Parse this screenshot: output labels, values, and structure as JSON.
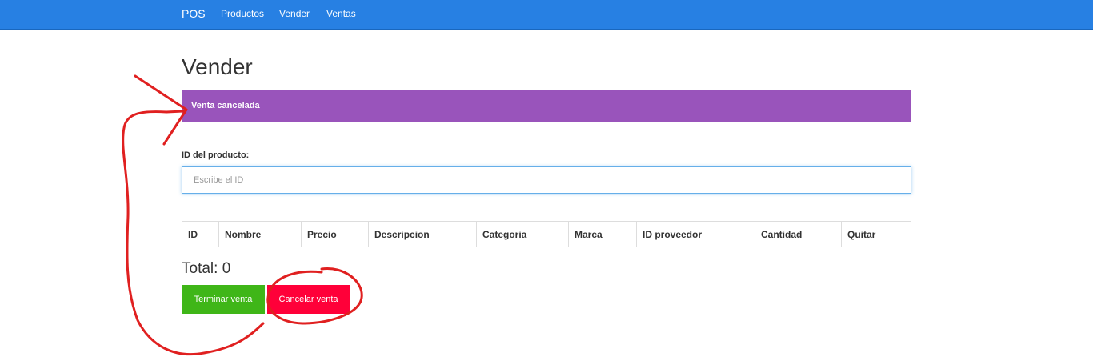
{
  "navbar": {
    "brand": "POS",
    "links": [
      "Productos",
      "Vender",
      "Ventas"
    ],
    "background": "#2780e3"
  },
  "page_title": "Vender",
  "alert": {
    "text": "Venta cancelada",
    "color": "#9954bb"
  },
  "product_form": {
    "label": "ID del producto:",
    "placeholder": "Escribe el ID",
    "value": ""
  },
  "table": {
    "columns": [
      "ID",
      "Nombre",
      "Precio",
      "Descripcion",
      "Categoria",
      "Marca",
      "ID proveedor",
      "Cantidad",
      "Quitar"
    ],
    "rows": []
  },
  "total": "Total: 0",
  "actions": {
    "finish_label": "Terminar venta",
    "finish_color": "#3fb618",
    "cancel_label": "Cancelar venta",
    "cancel_color": "#ff0039"
  },
  "annotation": {
    "color": "#e02020"
  }
}
